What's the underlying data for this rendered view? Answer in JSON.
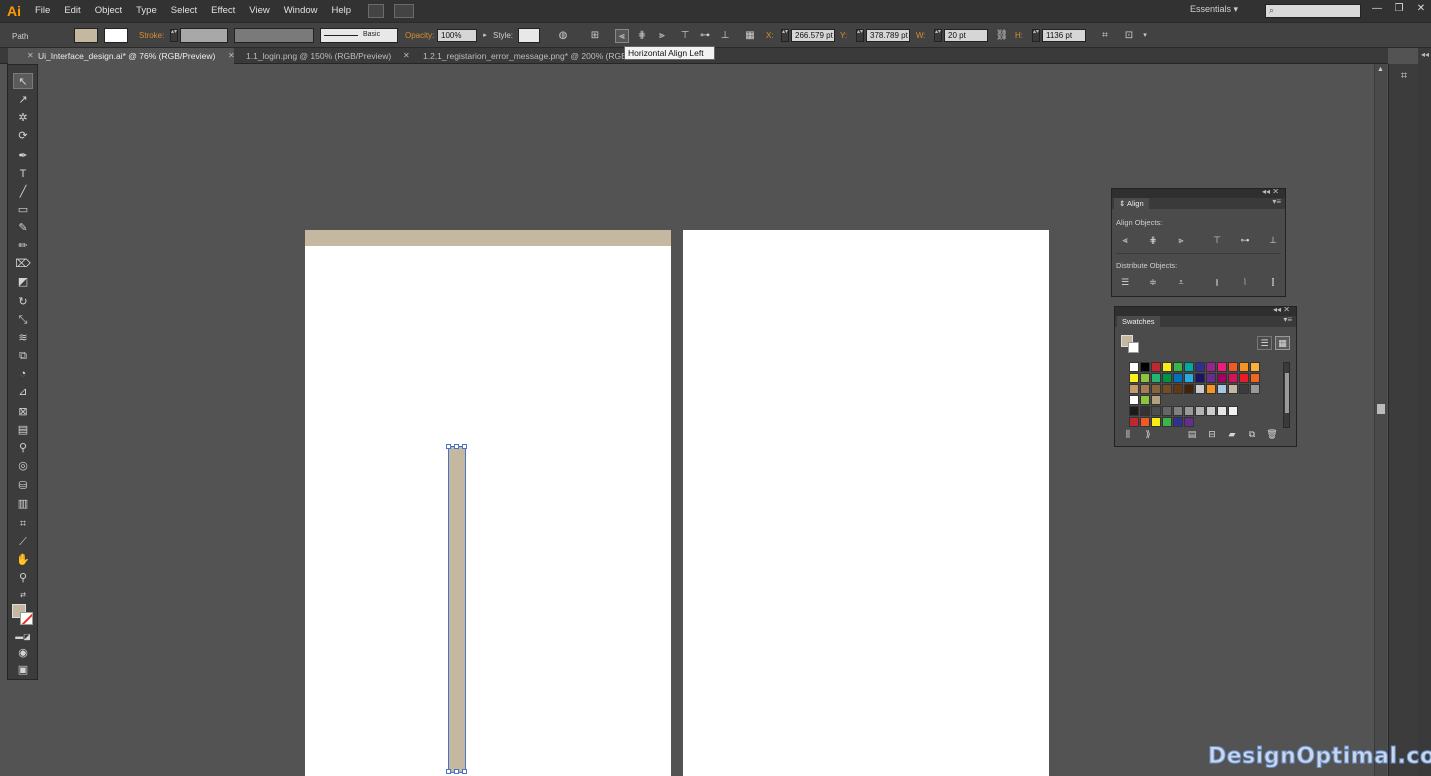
{
  "app": {
    "logo": "Ai"
  },
  "menu": [
    "File",
    "Edit",
    "Object",
    "Type",
    "Select",
    "Effect",
    "View",
    "Window",
    "Help"
  ],
  "workspace": "Essentials",
  "control_bar": {
    "selection_type": "Path",
    "stroke_label": "Stroke:",
    "brush_label": "Basic",
    "opacity_label": "Opacity:",
    "opacity_value": "100%",
    "style_label": "Style:",
    "x_label": "X:",
    "x_value": "266.579 pt",
    "y_label": "Y:",
    "y_value": "378.789 pt",
    "w_label": "W:",
    "w_value": "20 pt",
    "h_label": "H:",
    "h_value": "1136 pt"
  },
  "tooltip": "Horizontal Align Left",
  "document_tabs": [
    {
      "label": "Ui_Interface_design.ai* @ 76% (RGB/Preview)",
      "active": true
    },
    {
      "label": "1.1_login.png @ 150% (RGB/Preview)",
      "active": false
    },
    {
      "label": "1.2.1_registarion_error_message.png* @ 200% (RGB/Preview)",
      "active": false
    }
  ],
  "colors": {
    "fill": "#c5b8a0",
    "accent": "#4a73d0",
    "app_logo": "#ff9a00"
  },
  "align_panel": {
    "tab": "Align",
    "align_objects": "Align Objects:",
    "distribute_objects": "Distribute Objects:"
  },
  "swatches_panel": {
    "tab": "Swatches"
  },
  "watermark": "DesignOptimal.com"
}
